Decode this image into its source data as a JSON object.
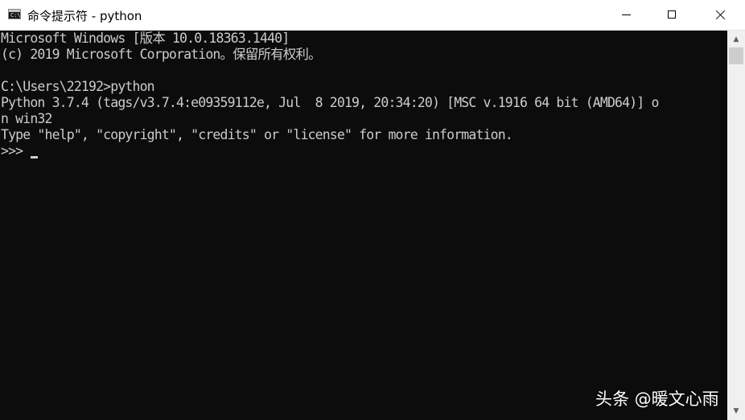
{
  "window": {
    "title": "命令提示符 - python",
    "icon": "cmd-icon",
    "controls": {
      "minimize_icon": "minimize-icon",
      "maximize_icon": "maximize-icon",
      "close_icon": "close-icon"
    }
  },
  "console": {
    "lines": [
      "Microsoft Windows [版本 10.0.18363.1440]",
      "(c) 2019 Microsoft Corporation。保留所有权利。",
      "",
      "C:\\Users\\22192>python",
      "Python 3.7.4 (tags/v3.7.4:e09359112e, Jul  8 2019, 20:34:20) [MSC v.1916 64 bit (AMD64)] o",
      "n win32",
      "Type \"help\", \"copyright\", \"credits\" or \"license\" for more information.",
      ">>> "
    ],
    "colors": {
      "background": "#0c0c0c",
      "text": "#cccccc"
    }
  },
  "scrollbar": {
    "up_icon": "scroll-up-arrow-icon",
    "down_icon": "scroll-down-arrow-icon"
  },
  "watermark": {
    "text": "头条 @暖文心雨"
  }
}
